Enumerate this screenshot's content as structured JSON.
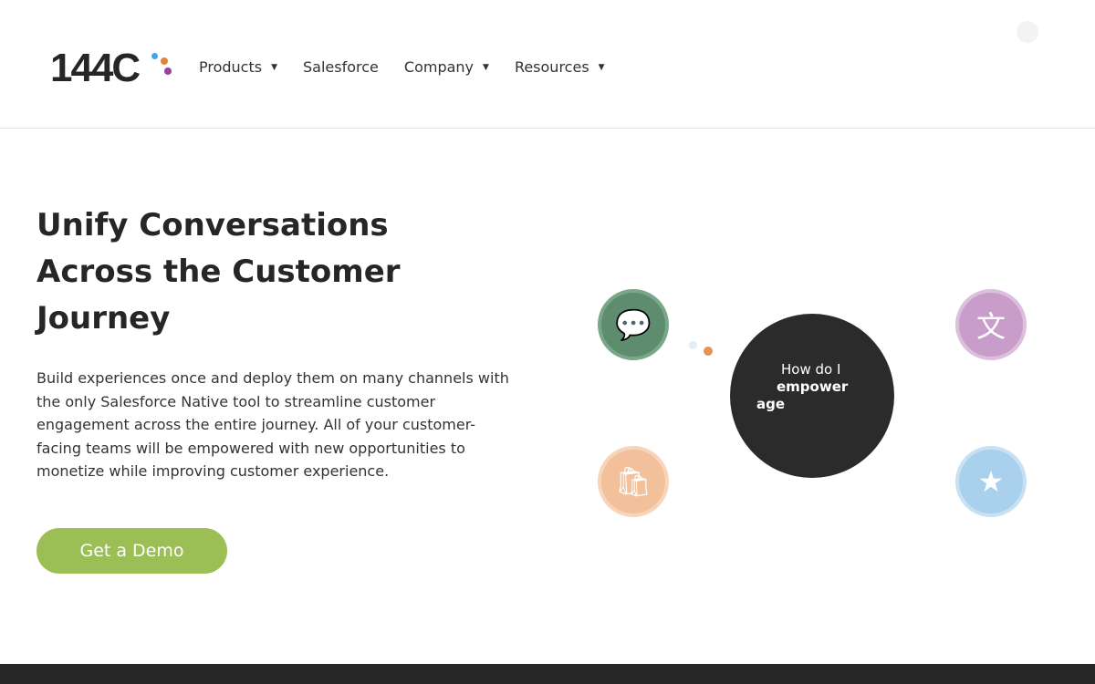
{
  "header": {
    "logo_text": "144C",
    "nav": [
      {
        "label": "Products",
        "has_dropdown": true
      },
      {
        "label": "Salesforce",
        "has_dropdown": false
      },
      {
        "label": "Company",
        "has_dropdown": true
      },
      {
        "label": "Resources",
        "has_dropdown": true
      }
    ],
    "caret": "▼"
  },
  "hero": {
    "title": "Unify Conversations Across the Customer Journey",
    "description": "Build experiences once and deploy them on many channels with the only Salesforce Native tool to streamline customer engagement across the entire journey. All of your customer-facing teams will be empowered with new opportunities to monetize while improving customer experience.",
    "cta_label": "Get a Demo"
  },
  "illustration": {
    "line1": "How do I",
    "line2": "empower",
    "line3": "age",
    "icons": [
      {
        "name": "chat-icon",
        "color": "#5e8c6e",
        "glyph": "💬"
      },
      {
        "name": "translate-icon",
        "color": "#c99dca",
        "glyph": "文"
      },
      {
        "name": "shopping-bag-icon",
        "color": "#f2c09a",
        "glyph": "🛍"
      },
      {
        "name": "shield-star-icon",
        "color": "#a9d0ec",
        "glyph": "★"
      }
    ]
  },
  "colors": {
    "accent": "#9bbf54",
    "dark": "#262626"
  }
}
